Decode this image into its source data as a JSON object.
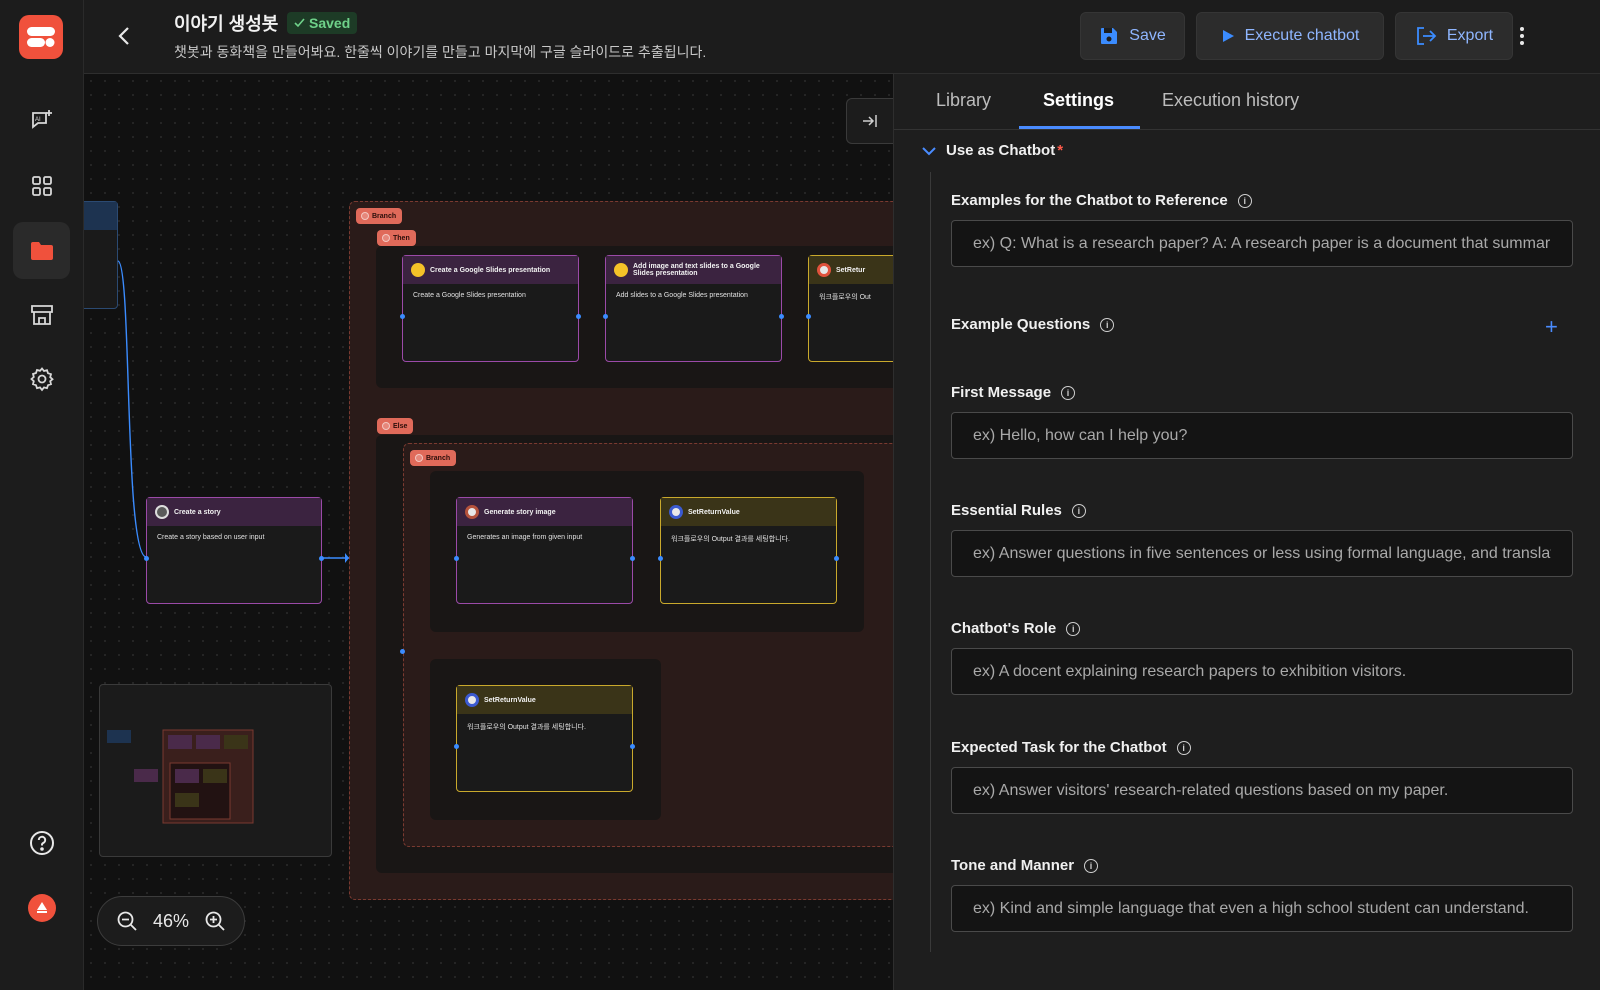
{
  "header": {
    "title": "이야기 생성봇",
    "saved_label": "Saved",
    "subtitle": "챗봇과 동화책을 만들어봐요. 한줄씩 이야기를 만들고 마지막에 구글 슬라이드로 추출됩니다.",
    "save_label": "Save",
    "execute_label": "Execute chatbot",
    "export_label": "Export"
  },
  "sidebar": {
    "items": [
      {
        "icon": "ai-chat-icon"
      },
      {
        "icon": "apps-grid-icon"
      },
      {
        "icon": "folder-icon"
      },
      {
        "icon": "store-icon"
      },
      {
        "icon": "gear-icon"
      },
      {
        "icon": "help-icon"
      },
      {
        "icon": "user-avatar-icon"
      }
    ]
  },
  "canvas": {
    "zoom": "46%",
    "tags": {
      "branch": "Branch",
      "then": "Then",
      "else": "Else"
    },
    "nodes": {
      "create_story": {
        "title": "Create a story",
        "body": "Create a story based on user input"
      },
      "create_slides": {
        "title": "Create a Google Slides presentation",
        "body": "Create a Google Slides presentation"
      },
      "add_slides": {
        "title": "Add image and text slides to a Google Slides presentation",
        "body": "Add slides to a Google Slides presentation"
      },
      "set_return_top": {
        "title": "SetRetur",
        "body": "워크플로우의 Out"
      },
      "gen_image": {
        "title": "Generate story image",
        "body": "Generates an image from given input"
      },
      "set_return_mid": {
        "title": "SetReturnValue",
        "body": "워크플로우의 Output 결과를 세팅합니다."
      },
      "set_return_bottom": {
        "title": "SetReturnValue",
        "body": "워크플로우의 Output 결과를 세팅합니다."
      }
    }
  },
  "panel": {
    "tabs": [
      "Library",
      "Settings",
      "Execution history"
    ],
    "active_tab": "Settings",
    "section": "Use as Chatbot",
    "required_mark": "*",
    "fields": {
      "examples": {
        "label": "Examples for the Chatbot to Reference",
        "placeholder": "ex) Q: What is a research paper? A: A research paper is a document that summarizes"
      },
      "example_questions": {
        "label": "Example Questions"
      },
      "first_message": {
        "label": "First Message",
        "placeholder": "ex) Hello, how can I help you?"
      },
      "essential_rules": {
        "label": "Essential Rules",
        "placeholder": "ex) Answer questions in five sentences or less using formal language, and translate"
      },
      "role": {
        "label": "Chatbot's Role",
        "placeholder": "ex) A docent explaining research papers to exhibition visitors."
      },
      "expected_task": {
        "label": "Expected Task for the Chatbot",
        "placeholder": "ex) Answer visitors' research-related questions based on my paper."
      },
      "tone": {
        "label": "Tone and Manner",
        "placeholder": "ex) Kind and simple language that even a high school student can understand."
      }
    }
  },
  "colors": {
    "accent": "#4a8cff",
    "brand": "#f0513c",
    "saved": "#6fd28a"
  }
}
